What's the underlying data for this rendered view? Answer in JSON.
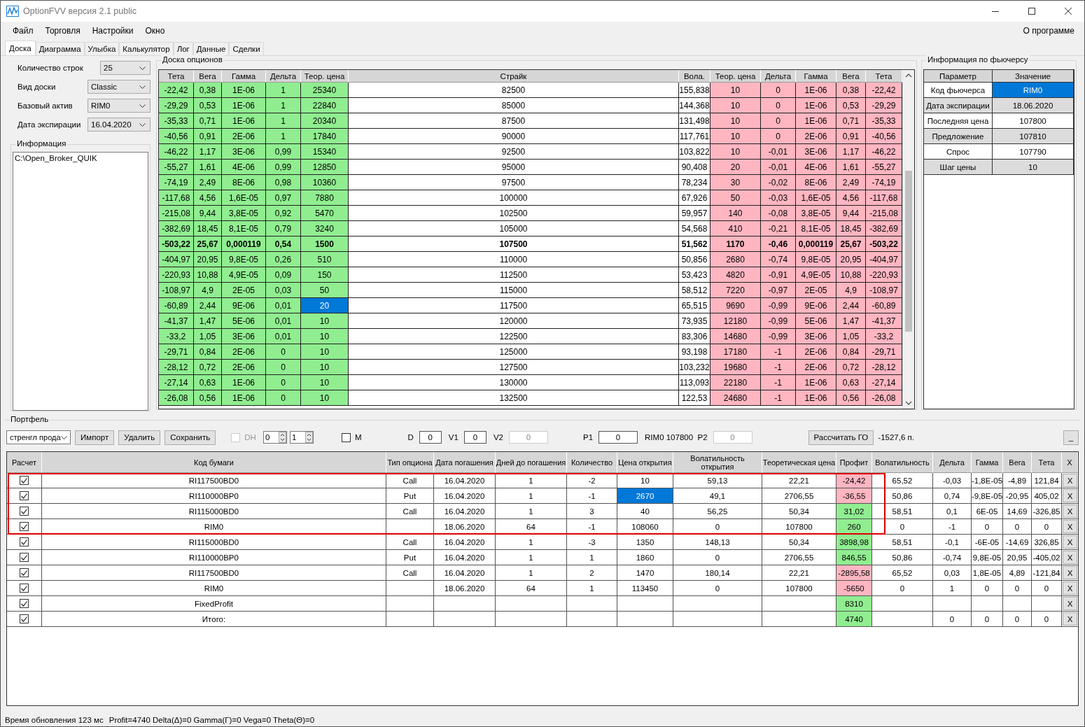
{
  "window": {
    "title": "OptionFVV версия 2.1 public"
  },
  "menu": {
    "items": [
      "Файл",
      "Торговля",
      "Настройки",
      "Окно"
    ],
    "about": "О программе"
  },
  "tabs": [
    {
      "label": "Доска",
      "selected": true
    },
    {
      "label": "Диаграмма",
      "selected": false
    },
    {
      "label": "Улыбка",
      "selected": false
    },
    {
      "label": "Калькулятор",
      "selected": false
    },
    {
      "label": "Лог",
      "selected": false
    },
    {
      "label": "Данные",
      "selected": false
    },
    {
      "label": "Сделки",
      "selected": false
    }
  ],
  "settings": [
    {
      "label": "Количество строк",
      "value": "25"
    },
    {
      "label": "Вид доски",
      "value": "Classic"
    },
    {
      "label": "Базовый актив",
      "value": "RIM0"
    },
    {
      "label": "Дата экспирации",
      "value": "16.04.2020"
    }
  ],
  "info": {
    "title": "Информация",
    "text": "C:\\Open_Broker_QUIK"
  },
  "board": {
    "title": "Доска опционов",
    "columns": [
      "Тета",
      "Вега",
      "Гамма",
      "Дельта",
      "Теор. цена",
      "Страйк",
      "Вола.",
      "Теор. цена",
      "Дельта",
      "Гамма",
      "Вега",
      "Тета"
    ],
    "rows": [
      {
        "cells": [
          "-22,42",
          "0,38",
          "1E-06",
          "1",
          "25340",
          "82500",
          "155,838",
          "10",
          "0",
          "1E-06",
          "0,38",
          "-22,42"
        ],
        "atm": false,
        "selected": false
      },
      {
        "cells": [
          "-29,29",
          "0,53",
          "1E-06",
          "1",
          "22840",
          "85000",
          "144,368",
          "10",
          "0",
          "1E-06",
          "0,53",
          "-29,29"
        ],
        "atm": false,
        "selected": false
      },
      {
        "cells": [
          "-35,33",
          "0,71",
          "1E-06",
          "1",
          "20340",
          "87500",
          "131,498",
          "10",
          "0",
          "1E-06",
          "0,71",
          "-35,33"
        ],
        "atm": false,
        "selected": false
      },
      {
        "cells": [
          "-40,56",
          "0,91",
          "2E-06",
          "1",
          "17840",
          "90000",
          "117,761",
          "10",
          "0",
          "2E-06",
          "0,91",
          "-40,56"
        ],
        "atm": false,
        "selected": false
      },
      {
        "cells": [
          "-46,22",
          "1,17",
          "3E-06",
          "0,99",
          "15340",
          "92500",
          "103,822",
          "10",
          "-0,01",
          "3E-06",
          "1,17",
          "-46,22"
        ],
        "atm": false,
        "selected": false
      },
      {
        "cells": [
          "-55,27",
          "1,61",
          "4E-06",
          "0,99",
          "12850",
          "95000",
          "90,408",
          "20",
          "-0,01",
          "4E-06",
          "1,61",
          "-55,27"
        ],
        "atm": false,
        "selected": false
      },
      {
        "cells": [
          "-74,19",
          "2,49",
          "8E-06",
          "0,98",
          "10360",
          "97500",
          "78,234",
          "30",
          "-0,02",
          "8E-06",
          "2,49",
          "-74,19"
        ],
        "atm": false,
        "selected": false
      },
      {
        "cells": [
          "-117,68",
          "4,56",
          "1,6E-05",
          "0,97",
          "7880",
          "100000",
          "67,926",
          "50",
          "-0,03",
          "1,6E-05",
          "4,56",
          "-117,68"
        ],
        "atm": false,
        "selected": false
      },
      {
        "cells": [
          "-215,08",
          "9,44",
          "3,8E-05",
          "0,92",
          "5470",
          "102500",
          "59,957",
          "140",
          "-0,08",
          "3,8E-05",
          "9,44",
          "-215,08"
        ],
        "atm": false,
        "selected": false
      },
      {
        "cells": [
          "-382,69",
          "18,45",
          "8,1E-05",
          "0,79",
          "3240",
          "105000",
          "54,568",
          "410",
          "-0,21",
          "8,1E-05",
          "18,45",
          "-382,69"
        ],
        "atm": false,
        "selected": false
      },
      {
        "cells": [
          "-503,22",
          "25,67",
          "0,000119",
          "0,54",
          "1500",
          "107500",
          "51,562",
          "1170",
          "-0,46",
          "0,000119",
          "25,67",
          "-503,22"
        ],
        "atm": true,
        "selected": false
      },
      {
        "cells": [
          "-404,97",
          "20,95",
          "9,8E-05",
          "0,26",
          "510",
          "110000",
          "50,856",
          "2680",
          "-0,74",
          "9,8E-05",
          "20,95",
          "-404,97"
        ],
        "atm": false,
        "selected": false
      },
      {
        "cells": [
          "-220,93",
          "10,88",
          "4,9E-05",
          "0,09",
          "150",
          "112500",
          "53,423",
          "4820",
          "-0,91",
          "4,9E-05",
          "10,88",
          "-220,93"
        ],
        "atm": false,
        "selected": false
      },
      {
        "cells": [
          "-108,97",
          "4,9",
          "2E-05",
          "0,03",
          "50",
          "115000",
          "58,512",
          "7220",
          "-0,97",
          "2E-05",
          "4,9",
          "-108,97"
        ],
        "atm": false,
        "selected": false
      },
      {
        "cells": [
          "-60,89",
          "2,44",
          "9E-06",
          "0,01",
          "20",
          "117500",
          "65,515",
          "9690",
          "-0,99",
          "9E-06",
          "2,44",
          "-60,89"
        ],
        "atm": false,
        "selected": true
      },
      {
        "cells": [
          "-41,37",
          "1,47",
          "5E-06",
          "0,01",
          "10",
          "120000",
          "73,935",
          "12180",
          "-0,99",
          "5E-06",
          "1,47",
          "-41,37"
        ],
        "atm": false,
        "selected": false
      },
      {
        "cells": [
          "-33,2",
          "1,05",
          "3E-06",
          "0,01",
          "10",
          "122500",
          "83,306",
          "14680",
          "-0,99",
          "3E-06",
          "1,05",
          "-33,2"
        ],
        "atm": false,
        "selected": false
      },
      {
        "cells": [
          "-29,71",
          "0,84",
          "2E-06",
          "0",
          "10",
          "125000",
          "93,198",
          "17180",
          "-1",
          "2E-06",
          "0,84",
          "-29,71"
        ],
        "atm": false,
        "selected": false
      },
      {
        "cells": [
          "-28,12",
          "0,72",
          "2E-06",
          "0",
          "10",
          "127500",
          "103,232",
          "19680",
          "-1",
          "2E-06",
          "0,72",
          "-28,12"
        ],
        "atm": false,
        "selected": false
      },
      {
        "cells": [
          "-27,14",
          "0,63",
          "1E-06",
          "0",
          "10",
          "130000",
          "113,093",
          "22180",
          "-1",
          "1E-06",
          "0,63",
          "-27,14"
        ],
        "atm": false,
        "selected": false
      },
      {
        "cells": [
          "-26,08",
          "0,56",
          "1E-06",
          "0",
          "10",
          "132500",
          "122,53",
          "24680",
          "-1",
          "1E-06",
          "0,56",
          "-26,08"
        ],
        "atm": false,
        "selected": false
      }
    ]
  },
  "futures": {
    "title": "Информация по фьючерсу",
    "columns": [
      "Параметр",
      "Значение"
    ],
    "rows": [
      {
        "param": "Код фьючерса",
        "value": "RIM0",
        "selected": true
      },
      {
        "param": "Дата экспирации",
        "value": "18.06.2020",
        "selected": false
      },
      {
        "param": "Последняя цена",
        "value": "107800",
        "selected": false
      },
      {
        "param": "Предложение",
        "value": "107810",
        "selected": false
      },
      {
        "param": "Спрос",
        "value": "107790",
        "selected": false
      },
      {
        "param": "Шаг цены",
        "value": "10",
        "selected": false
      }
    ]
  },
  "portfolio": {
    "title": "Портфель",
    "toolbar": {
      "strategy": "стренгл прода",
      "import": "Импорт",
      "delete": "Удалить",
      "save": "Сохранить",
      "dh_label": "DH",
      "dh_checked": false,
      "spin_1": "0",
      "spin_2": "1",
      "m_label": "M",
      "m_checked": false,
      "fields": [
        {
          "label": "D",
          "value": "0",
          "disabled": false
        },
        {
          "label": "V1",
          "value": "0",
          "disabled": false
        },
        {
          "label": "V2",
          "value": "0",
          "disabled": true
        },
        {
          "label": "P1",
          "value": "0",
          "disabled": false
        },
        {
          "label": "RIM0 107800  P2",
          "value": "0",
          "disabled": true
        }
      ],
      "margin_button": "Рассчитать ГО",
      "margin_value": "-1527,6 п.",
      "minimize": "_"
    },
    "check_column": "Расчет",
    "remove_column": "X",
    "columns": [
      "Код бумаги",
      "Тип опциона",
      "Дата погашения",
      "Дней до погашения",
      "Количество",
      "Цена открытия",
      "Волатильность открытия",
      "Теоретическая цена",
      "Профит",
      "Волатильность",
      "Дельта",
      "Гамма",
      "Вега",
      "Тета"
    ],
    "rows": [
      {
        "checked": true,
        "highlighted": true,
        "selected": false,
        "color": "#ffb6c1",
        "cells": [
          "RI117500BD0",
          "Call",
          "16.04.2020",
          "1",
          "-2",
          "10",
          "59,13",
          "22,21",
          "-24,42",
          "65,52",
          "-0,03",
          "-1,8E-05",
          "-4,89",
          "121,84"
        ],
        "remove": "X"
      },
      {
        "checked": true,
        "highlighted": true,
        "selected": true,
        "color": "#ffb6c1",
        "cells": [
          "RI110000BP0",
          "Put",
          "16.04.2020",
          "1",
          "-1",
          "2670",
          "49,1",
          "2706,55",
          "-36,55",
          "50,86",
          "0,74",
          "-9,8E-05",
          "-20,95",
          "405,02"
        ],
        "remove": "X"
      },
      {
        "checked": true,
        "highlighted": true,
        "selected": false,
        "color": "#90ee90",
        "cells": [
          "RI115000BD0",
          "Call",
          "16.04.2020",
          "1",
          "3",
          "40",
          "56,25",
          "50,34",
          "31,02",
          "58,51",
          "0,1",
          "6E-05",
          "14,69",
          "-326,85"
        ],
        "remove": "X"
      },
      {
        "checked": true,
        "highlighted": true,
        "selected": false,
        "color": "#90ee90",
        "cells": [
          "RIM0",
          null,
          "18.06.2020",
          "64",
          "-1",
          "108060",
          "0",
          "107800",
          "260",
          "0",
          "-1",
          "0",
          "0",
          "0"
        ],
        "remove": "X"
      },
      {
        "checked": true,
        "highlighted": false,
        "selected": false,
        "color": "#90ee90",
        "cells": [
          "RI115000BD0",
          "Call",
          "16.04.2020",
          "1",
          "-3",
          "1350",
          "148,13",
          "50,34",
          "3898,98",
          "58,51",
          "-0,1",
          "-6E-05",
          "-14,69",
          "326,85"
        ],
        "remove": "X"
      },
      {
        "checked": true,
        "highlighted": false,
        "selected": false,
        "color": "#90ee90",
        "cells": [
          "RI110000BP0",
          "Put",
          "16.04.2020",
          "1",
          "1",
          "1860",
          "0",
          "2706,55",
          "846,55",
          "50,86",
          "-0,74",
          "9,8E-05",
          "20,95",
          "-405,02"
        ],
        "remove": "X"
      },
      {
        "checked": true,
        "highlighted": false,
        "selected": false,
        "color": "#ffb6c1",
        "cells": [
          "RI117500BD0",
          "Call",
          "16.04.2020",
          "1",
          "2",
          "1470",
          "180,14",
          "22,21",
          "-2895,58",
          "65,52",
          "0,03",
          "1,8E-05",
          "4,89",
          "-121,84"
        ],
        "remove": "X"
      },
      {
        "checked": true,
        "highlighted": false,
        "selected": false,
        "color": "#ffb6c1",
        "cells": [
          "RIM0",
          null,
          "18.06.2020",
          "64",
          "1",
          "113450",
          "0",
          "107800",
          "-5650",
          "0",
          "1",
          "0",
          "0",
          "0"
        ],
        "remove": "X"
      },
      {
        "checked": true,
        "highlighted": false,
        "selected": false,
        "color": "#90ee90",
        "cells": [
          "FixedProfit",
          null,
          null,
          null,
          null,
          null,
          null,
          null,
          "8310",
          null,
          null,
          null,
          null,
          null
        ],
        "remove": "X"
      },
      {
        "checked": true,
        "highlighted": false,
        "selected": false,
        "color": "#90ee90",
        "cells": [
          "Итого:",
          null,
          null,
          null,
          null,
          null,
          null,
          null,
          "4740",
          null,
          "0",
          "0",
          "0",
          "0"
        ],
        "remove": "X"
      }
    ]
  },
  "status_bar": {
    "update_time": "Время обновления 123 мс",
    "totals": "Profit=4740 Delta(Δ)=0 Gamma(Γ)=0 Vega=0 Theta(Θ)=0"
  }
}
